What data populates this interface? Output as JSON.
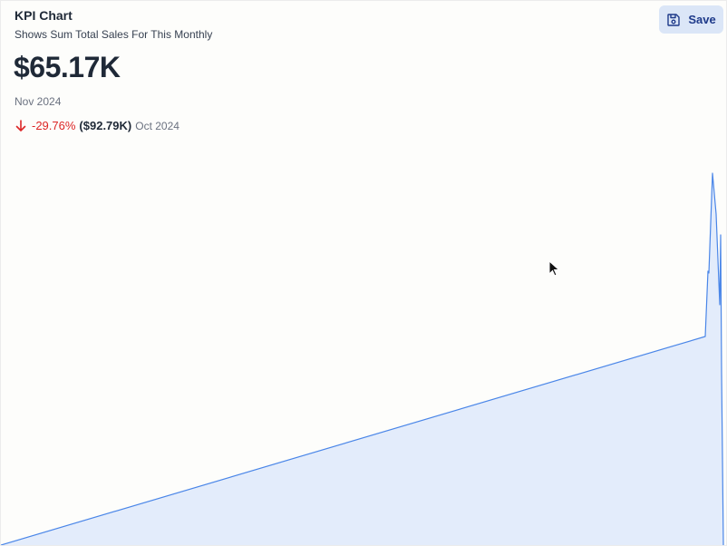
{
  "kpi": {
    "title": "KPI Chart",
    "subtitle": "Shows Sum Total Sales For This Monthly",
    "value": "$65.17K",
    "period": "Nov 2024",
    "change_pct": "-29.76%",
    "previous_value": "($92.79K)",
    "previous_period": "Oct 2024",
    "trend_icon": "arrow-down-icon"
  },
  "toolbar": {
    "save_label": "Save",
    "save_icon": "save-icon"
  },
  "colors": {
    "accent": "#4a86e8",
    "area_fill": "#e3ecfb",
    "negative": "#dc2626"
  }
}
